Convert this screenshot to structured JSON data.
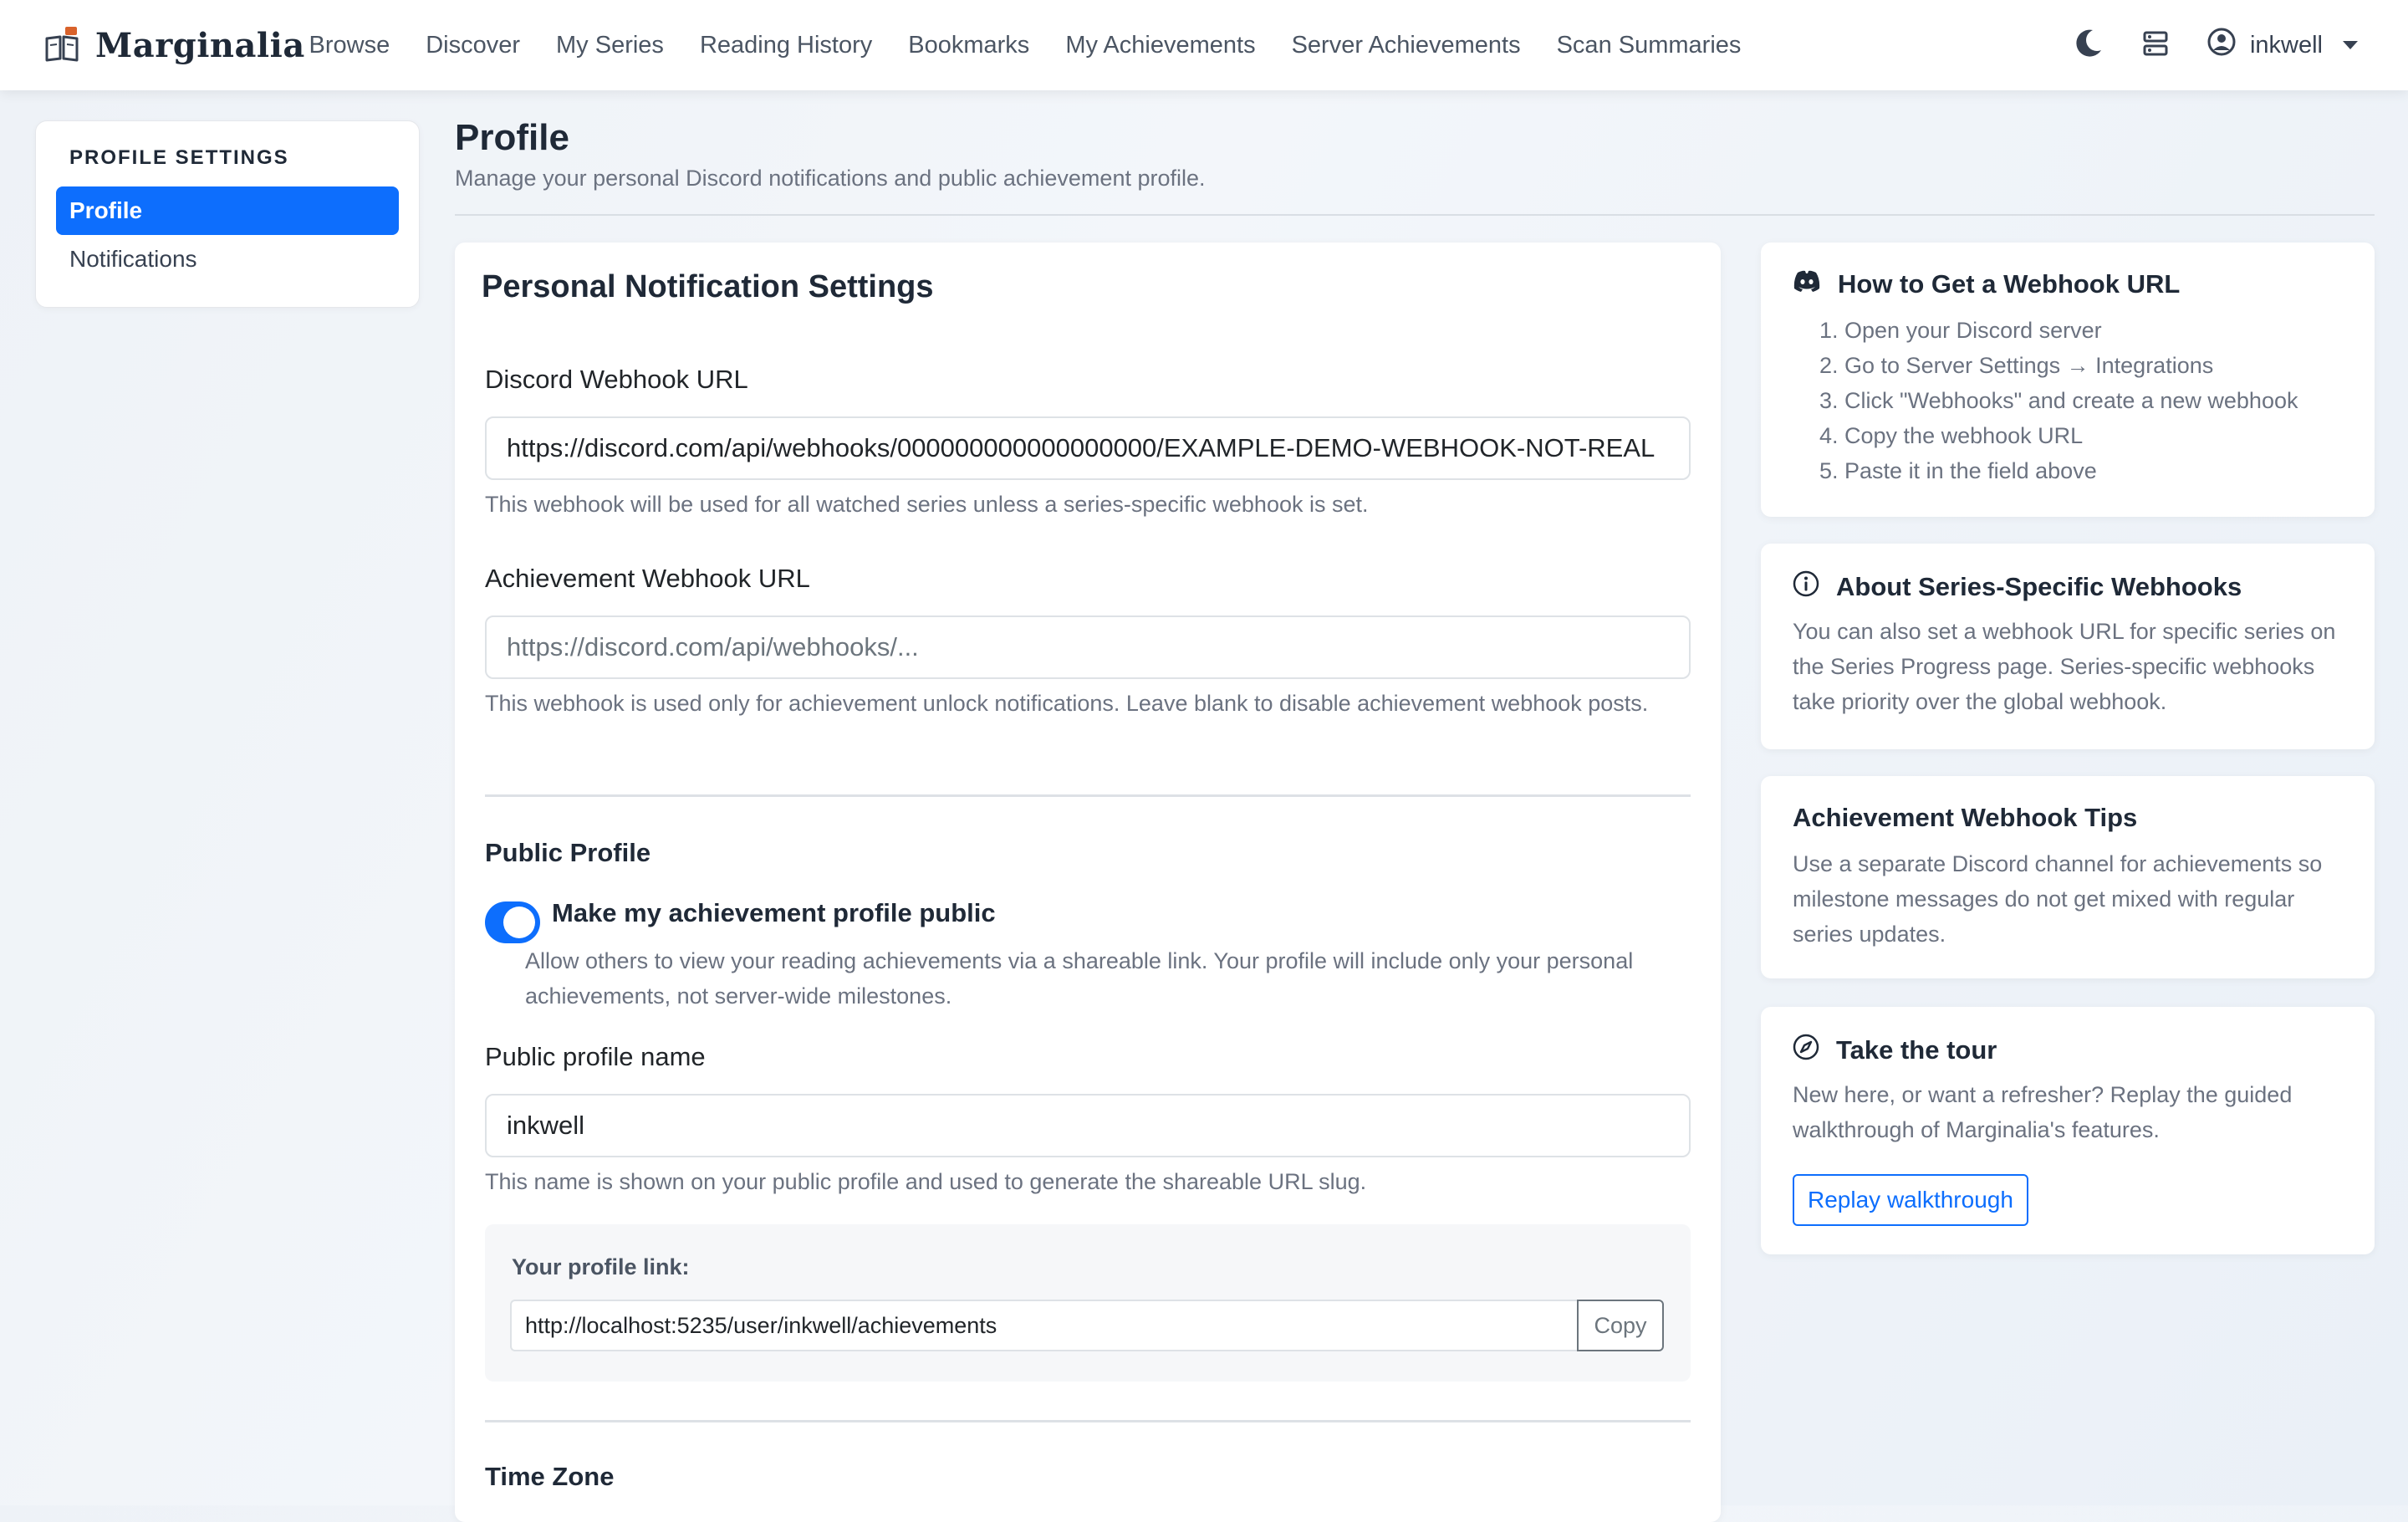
{
  "app": {
    "name": "Marginalia"
  },
  "nav": {
    "links": [
      "Browse",
      "Discover",
      "My Series",
      "Reading History",
      "Bookmarks",
      "My Achievements",
      "Server Achievements",
      "Scan Summaries"
    ],
    "username": "inkwell"
  },
  "sidebar": {
    "heading": "PROFILE SETTINGS",
    "items": [
      {
        "label": "Profile",
        "active": true
      },
      {
        "label": "Notifications",
        "active": false
      }
    ]
  },
  "page": {
    "title": "Profile",
    "subtitle": "Manage your personal Discord notifications and public achievement profile."
  },
  "settings": {
    "card_title": "Personal Notification Settings",
    "discord_webhook": {
      "label": "Discord Webhook URL",
      "value": "https://discord.com/api/webhooks/000000000000000000/EXAMPLE-DEMO-WEBHOOK-NOT-REAL",
      "help": "This webhook will be used for all watched series unless a series-specific webhook is set."
    },
    "achievement_webhook": {
      "label": "Achievement Webhook URL",
      "placeholder": "https://discord.com/api/webhooks/...",
      "value": "",
      "help": "This webhook is used only for achievement unlock notifications. Leave blank to disable achievement webhook posts."
    },
    "public_profile": {
      "section_title": "Public Profile",
      "toggle_label": "Make my achievement profile public",
      "toggle_on": true,
      "toggle_help": "Allow others to view your reading achievements via a shareable link. Your profile will include only your personal achievements, not server-wide milestones.",
      "name_label": "Public profile name",
      "name_value": "inkwell",
      "name_help": "This name is shown on your public profile and used to generate the shareable URL slug.",
      "link_label": "Your profile link:",
      "link_value": "http://localhost:5235/user/inkwell/achievements",
      "copy_label": "Copy"
    },
    "timezone": {
      "section_title": "Time Zone"
    }
  },
  "help_cards": {
    "webhook_howto": {
      "title": "How to Get a Webhook URL",
      "steps": [
        "1. Open your Discord server",
        "2. Go to Server Settings → Integrations",
        "3. Click \"Webhooks\" and create a new webhook",
        "4. Copy the webhook URL",
        "5. Paste it in the field above"
      ]
    },
    "series_webhooks": {
      "title": "About Series-Specific Webhooks",
      "body": "You can also set a webhook URL for specific series on the Series Progress page. Series-specific webhooks take priority over the global webhook."
    },
    "achievement_tips": {
      "title": "Achievement Webhook Tips",
      "body": "Use a separate Discord channel for achievements so milestone messages do not get mixed with regular series updates."
    },
    "tour": {
      "title": "Take the tour",
      "body": "New here, or want a refresher? Replay the guided walkthrough of Marginalia's features.",
      "button": "Replay walkthrough"
    }
  },
  "colors": {
    "accent": "#0d6efd",
    "text": "#212529",
    "muted": "#6b7280"
  }
}
